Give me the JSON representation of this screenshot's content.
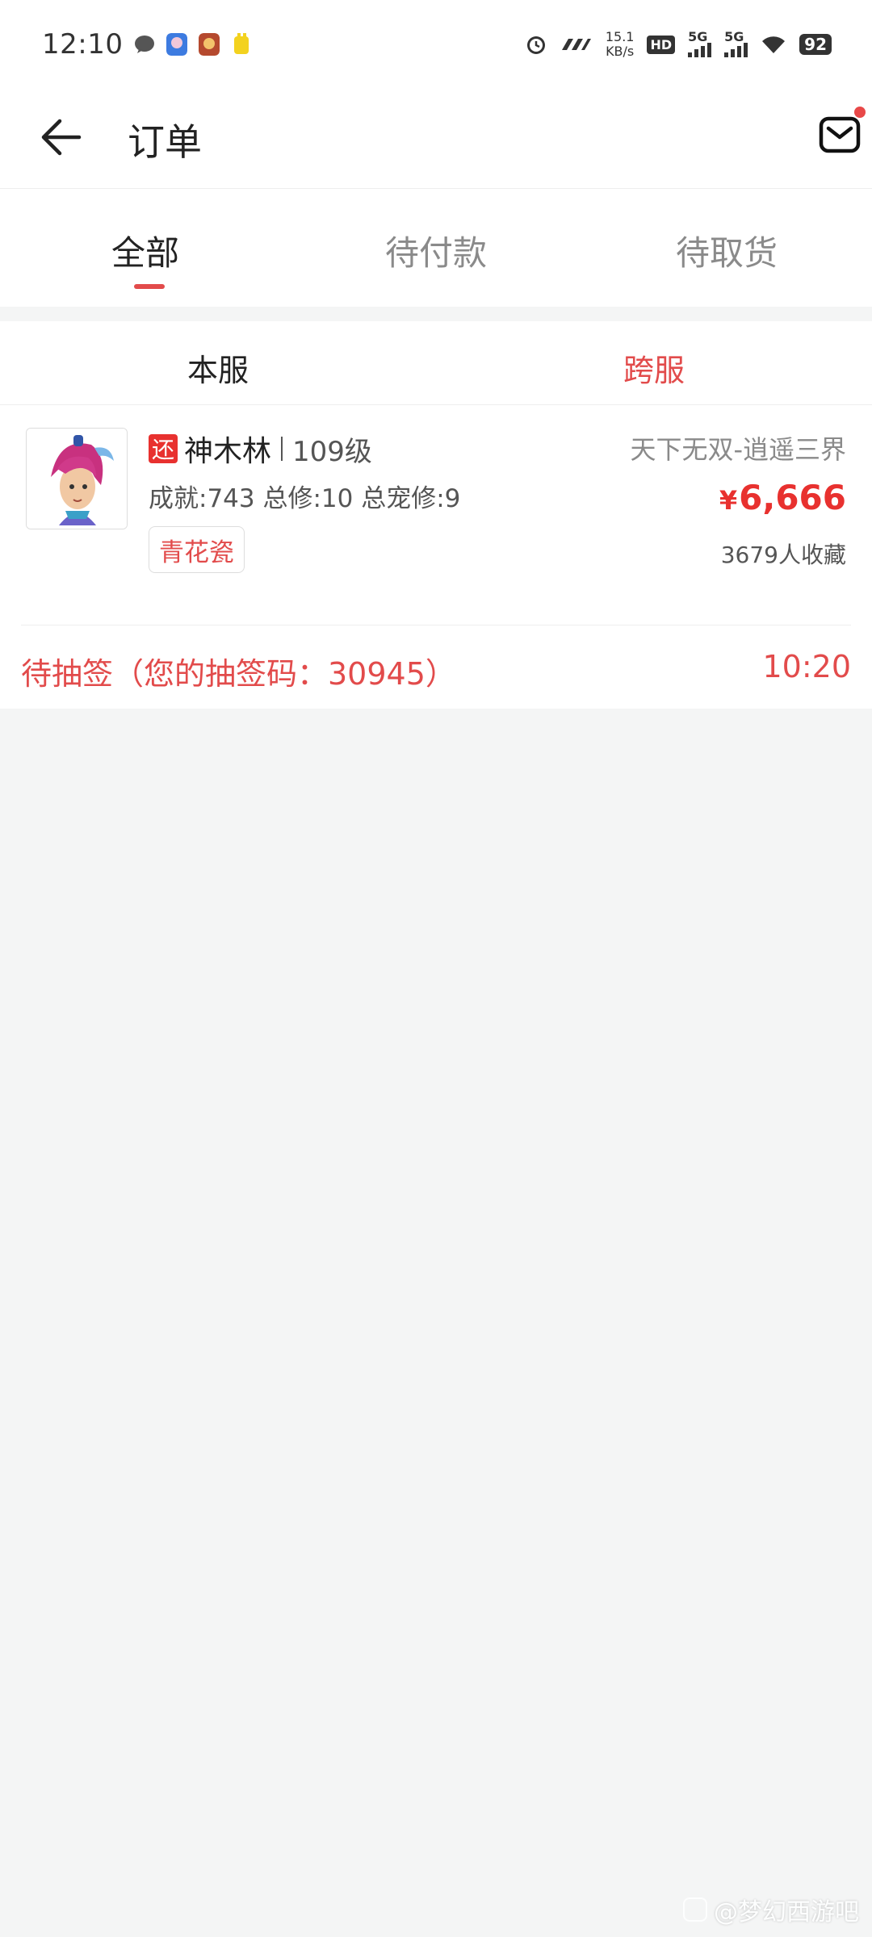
{
  "status_bar": {
    "time": "12:10",
    "net_speed_value": "15.1",
    "net_speed_unit": "KB/s",
    "hd_label": "HD",
    "signal1_label": "5G",
    "signal2_label": "5G",
    "battery": "92",
    "icons": [
      "message-icon",
      "game-app-icon",
      "game-app-icon",
      "app-icon",
      "alarm-icon",
      "nfc-icon",
      "hd-icon",
      "signal-icon",
      "signal-icon",
      "wifi-icon",
      "battery-icon"
    ]
  },
  "header": {
    "title": "订单",
    "back_icon": "back-arrow-icon",
    "mail_icon": "mail-icon"
  },
  "tabs": [
    {
      "label": "全部",
      "active": true
    },
    {
      "label": "待付款",
      "active": false
    },
    {
      "label": "待取货",
      "active": false
    }
  ],
  "subtabs": [
    {
      "label": "本服",
      "active": false
    },
    {
      "label": "跨服",
      "active": true
    }
  ],
  "order": {
    "badge": "还",
    "name": "神木林",
    "level": "109级",
    "stats": "成就:743 总修:10 总宠修:9",
    "tag": "青花瓷",
    "server": "天下无双-逍遥三界",
    "price_symbol": "¥",
    "price_value": "6,666",
    "favorites": "3679人收藏",
    "lottery_status": "待抽签（您的抽签码：30945）",
    "countdown": "10:20"
  },
  "watermark": "@梦幻西游吧",
  "colors": {
    "accent": "#e24b4b",
    "price": "#e8312f",
    "background": "#f4f5f5"
  }
}
